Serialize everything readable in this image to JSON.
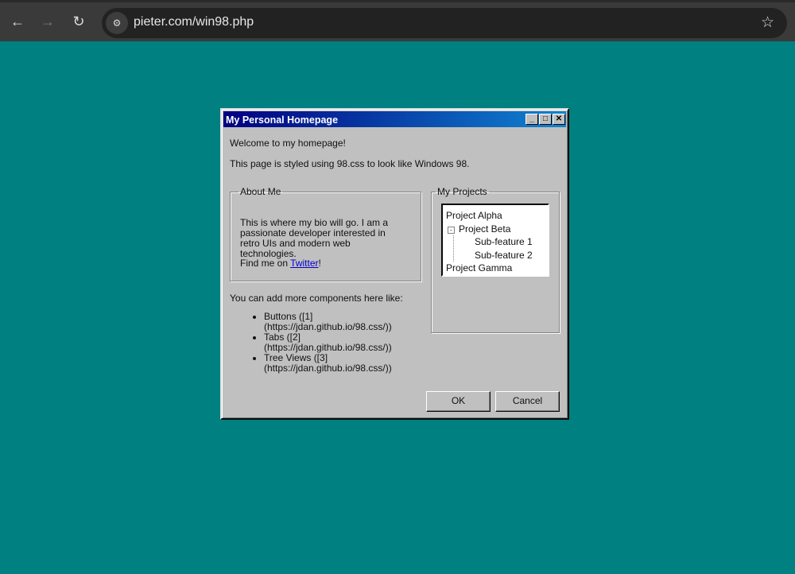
{
  "browser": {
    "url": "pieter.com/win98.php",
    "icons": [
      "back-icon",
      "forward-icon",
      "reload-icon",
      "site-settings-icon",
      "bookmark-star-icon"
    ]
  },
  "window": {
    "title": "My Personal Homepage",
    "minimize": "_",
    "maximize": "□",
    "close": "✕",
    "welcome": "Welcome to my homepage!",
    "styled": "This page is styled using 98.css to look like Windows 98.",
    "about": {
      "legend": "About Me",
      "bio": "This is where my bio will go. I am a passionate developer interested in retro UIs and modern web technologies.",
      "find_prefix": "Find me on ",
      "link": "Twitter",
      "find_suffix": "!"
    },
    "more": "You can add more components here like:",
    "list": [
      "Buttons ([1](https://jdan.github.io/98.css/))",
      "Tabs ([2](https://jdan.github.io/98.css/))",
      "Tree Views ([3](https://jdan.github.io/98.css/))"
    ],
    "projects": {
      "legend": "My Projects",
      "items": [
        "Project Alpha",
        "Project Beta",
        "Sub-feature 1",
        "Sub-feature 2",
        "Project Gamma"
      ],
      "expander": "-"
    },
    "ok": "OK",
    "cancel": "Cancel"
  }
}
